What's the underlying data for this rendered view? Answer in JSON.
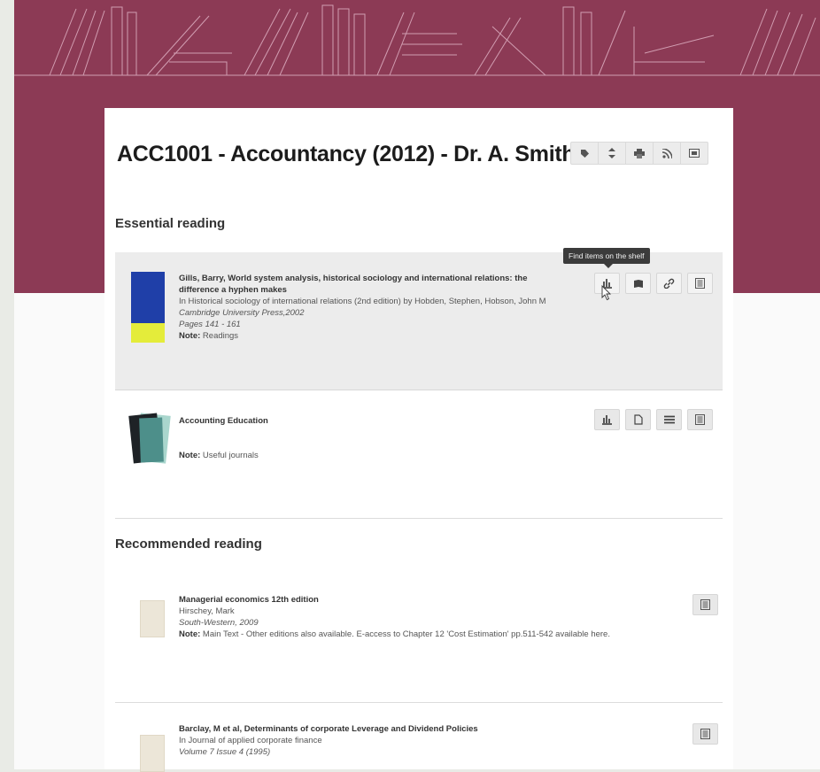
{
  "list": {
    "title": "ACC1001 - Accountancy (2012) - Dr. A. Smith",
    "toolbar": [
      {
        "icon": "tag-icon",
        "glyph": "tag"
      },
      {
        "icon": "sort-icon",
        "glyph": "sort"
      },
      {
        "icon": "print-icon",
        "glyph": "print"
      },
      {
        "icon": "rss-icon",
        "glyph": "rss"
      },
      {
        "icon": "export-icon",
        "glyph": "export"
      }
    ]
  },
  "tooltip": "Find items on the shelf",
  "sections": {
    "essential": {
      "heading": "Essential reading",
      "items": [
        {
          "title": "Gills, Barry, World system analysis, historical sociology and international relations: the difference a hyphen makes",
          "line1": "In Historical sociology of international relations (2nd edition) by Hobden, Stephen, Hobson, John M",
          "publisher": "Cambridge University Press,2002",
          "pages": "Pages 141 - 161",
          "note_label": "Note:",
          "note": "Readings",
          "cover_colors": {
            "top": "#1f3fa8",
            "bottom": "#e4ec3a"
          },
          "actions": [
            "shelf-icon",
            "book-icon",
            "link-icon",
            "barcode-icon"
          ]
        },
        {
          "title": "Accounting Education",
          "note_label": "Note:",
          "note": "Useful journals",
          "actions": [
            "shelf-icon",
            "file-icon",
            "list-icon",
            "barcode-icon"
          ]
        }
      ]
    },
    "recommended": {
      "heading": "Recommended reading",
      "items": [
        {
          "title": "Managerial economics 12th edition",
          "author": "Hirschey, Mark",
          "publisher": "South-Western, 2009",
          "note_label": "Note:",
          "note": "Main Text - Other editions also available. E-access to Chapter 12 'Cost Estimation' pp.511-542 available here.",
          "actions": [
            "barcode-icon"
          ]
        },
        {
          "title": "Barclay, M et al, Determinants of corporate Leverage and Dividend Policies",
          "line1": "In Journal of applied corporate finance",
          "volume": "Volume 7 Issue 4 (1995)",
          "actions": [
            "barcode-icon"
          ]
        }
      ]
    }
  },
  "colors": {
    "banner": "#8c3a55",
    "card": "#ffffff",
    "highlight": "#ececec"
  }
}
